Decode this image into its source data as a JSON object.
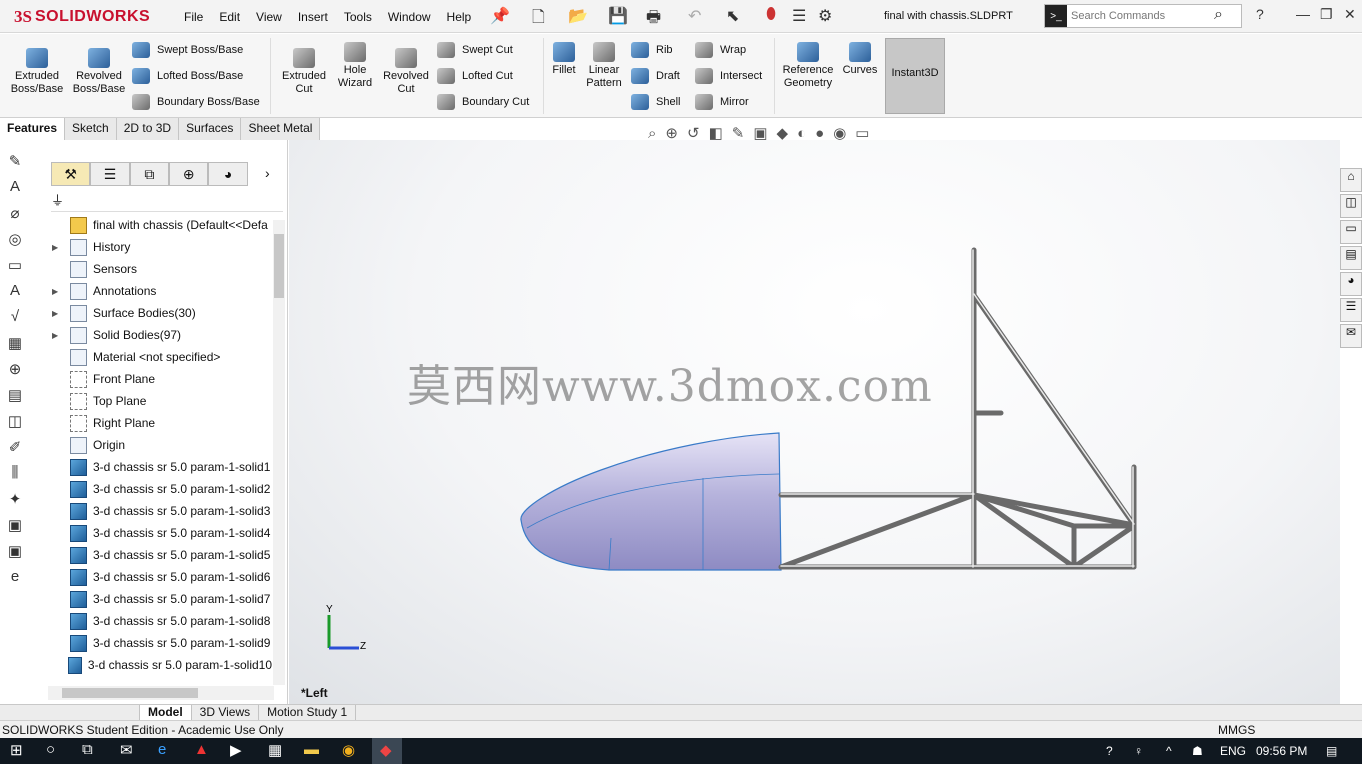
{
  "app": {
    "logo_ds": "3S",
    "logo_name": "SOLIDWORKS",
    "menus": [
      "File",
      "Edit",
      "View",
      "Insert",
      "Tools",
      "Window",
      "Help"
    ],
    "document_title": "final with chassis.SLDPRT",
    "search_placeholder": "Search Commands"
  },
  "ribbon": {
    "extruded_boss": "Extruded Boss/Base",
    "revolved_boss": "Revolved Boss/Base",
    "swept_boss": "Swept Boss/Base",
    "lofted_boss": "Lofted Boss/Base",
    "boundary_boss": "Boundary Boss/Base",
    "extruded_cut": "Extruded Cut",
    "hole_wizard": "Hole Wizard",
    "revolved_cut": "Revolved Cut",
    "swept_cut": "Swept Cut",
    "lofted_cut": "Lofted Cut",
    "boundary_cut": "Boundary Cut",
    "fillet": "Fillet",
    "linear_pattern": "Linear Pattern",
    "rib": "Rib",
    "draft": "Draft",
    "shell": "Shell",
    "wrap": "Wrap",
    "intersect": "Intersect",
    "mirror": "Mirror",
    "reference_geometry": "Reference Geometry",
    "curves": "Curves",
    "instant3d": "Instant3D"
  },
  "command_tabs": [
    "Features",
    "Sketch",
    "2D to 3D",
    "Surfaces",
    "Sheet Metal"
  ],
  "tree": {
    "root": "final with chassis  (Default<<Defa",
    "items": [
      {
        "label": "History",
        "expand": true,
        "icon": "folder"
      },
      {
        "label": "Sensors",
        "expand": false,
        "icon": "folder"
      },
      {
        "label": "Annotations",
        "expand": true,
        "icon": "annotation"
      },
      {
        "label": "Surface Bodies(30)",
        "expand": true,
        "icon": "folder"
      },
      {
        "label": "Solid Bodies(97)",
        "expand": true,
        "icon": "folder"
      },
      {
        "label": "Material <not specified>",
        "expand": false,
        "icon": "material"
      },
      {
        "label": "Front Plane",
        "expand": false,
        "icon": "plane"
      },
      {
        "label": "Top Plane",
        "expand": false,
        "icon": "plane"
      },
      {
        "label": "Right Plane",
        "expand": false,
        "icon": "plane"
      },
      {
        "label": "Origin",
        "expand": false,
        "icon": "origin"
      },
      {
        "label": "3-d chassis sr 5.0 param-1-solid1",
        "expand": false,
        "icon": "body"
      },
      {
        "label": "3-d chassis sr 5.0 param-1-solid2",
        "expand": false,
        "icon": "body"
      },
      {
        "label": "3-d chassis sr 5.0 param-1-solid3",
        "expand": false,
        "icon": "body"
      },
      {
        "label": "3-d chassis sr 5.0 param-1-solid4",
        "expand": false,
        "icon": "body"
      },
      {
        "label": "3-d chassis sr 5.0 param-1-solid5",
        "expand": false,
        "icon": "body"
      },
      {
        "label": "3-d chassis sr 5.0 param-1-solid6",
        "expand": false,
        "icon": "body"
      },
      {
        "label": "3-d chassis sr 5.0 param-1-solid7",
        "expand": false,
        "icon": "body"
      },
      {
        "label": "3-d chassis sr 5.0 param-1-solid8",
        "expand": false,
        "icon": "body"
      },
      {
        "label": "3-d chassis sr 5.0 param-1-solid9",
        "expand": false,
        "icon": "body"
      },
      {
        "label": "3-d chassis sr 5.0 param-1-solid10",
        "expand": false,
        "icon": "body"
      }
    ]
  },
  "viewport": {
    "watermark": "莫西网www.3dmox.com",
    "view_label": "*Left",
    "axis_y": "Y",
    "axis_z": "Z"
  },
  "bottom_tabs": [
    "Model",
    "3D Views",
    "Motion Study 1"
  ],
  "status": {
    "edition": "SOLIDWORKS Student Edition - Academic Use Only",
    "units": "MMGS"
  },
  "taskbar": {
    "language": "ENG",
    "time": "09:56 PM"
  }
}
